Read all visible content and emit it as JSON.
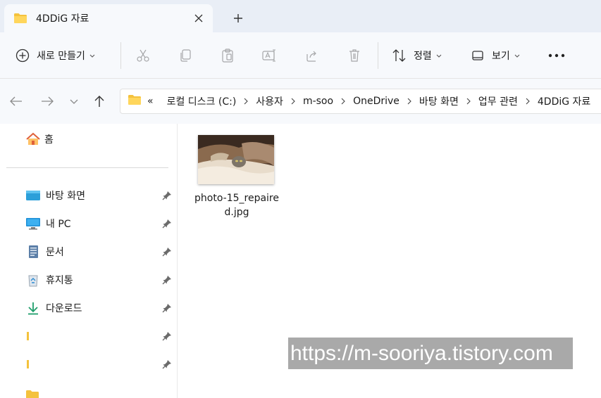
{
  "tab": {
    "title": "4DDiG 자료"
  },
  "toolbar": {
    "new_label": "새로 만들기",
    "sort_label": "정렬",
    "view_label": "보기"
  },
  "address": {
    "overflow": "«",
    "crumbs": [
      "로컬 디스크 (C:)",
      "사용자",
      "m-soo",
      "OneDrive",
      "바탕 화면",
      "업무 관련",
      "4DDiG 자료"
    ]
  },
  "sidebar": {
    "home": "홈",
    "items": [
      {
        "label": "바탕 화면",
        "icon": "desktop-icon"
      },
      {
        "label": "내 PC",
        "icon": "pc-icon"
      },
      {
        "label": "문서",
        "icon": "documents-icon"
      },
      {
        "label": "휴지통",
        "icon": "recycle-bin-icon"
      },
      {
        "label": "다운로드",
        "icon": "download-icon"
      },
      {
        "label": "",
        "icon": "folder-icon"
      },
      {
        "label": "",
        "icon": "folder-icon"
      }
    ]
  },
  "files": [
    {
      "name": "photo-15_repaired.jpg"
    }
  ],
  "watermark": "https://m-sooriya.tistory.com",
  "colors": {
    "accent": "#0067c0",
    "folder": "#f4c23d",
    "chrome": "#f7f9fc",
    "tabstrip": "#e9eef6"
  }
}
